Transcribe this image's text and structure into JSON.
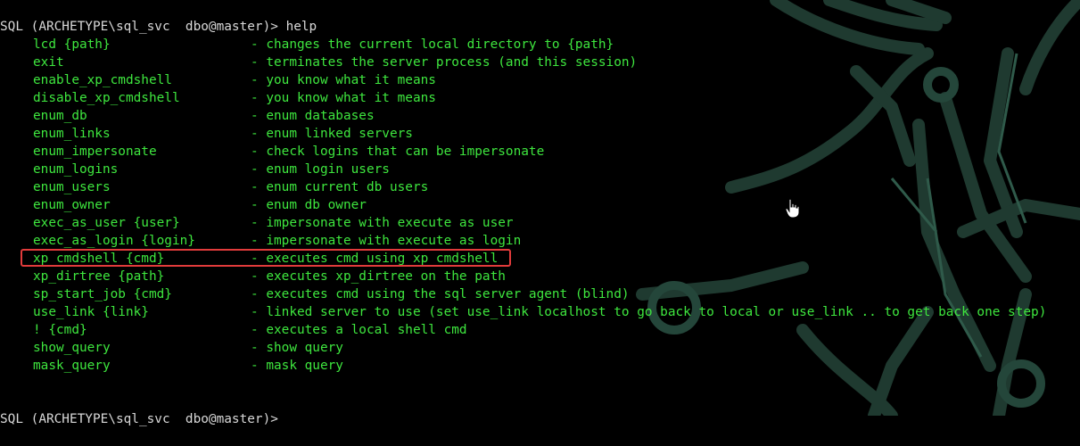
{
  "colors": {
    "background": "#000000",
    "prompt_text": "#d8d8d8",
    "help_text": "#3ee63e",
    "highlight_border": "#e23b3b",
    "watermark": "#1f3a30"
  },
  "terminal": {
    "prompt_1": "SQL (ARCHETYPE\\sql_svc  dbo@master)>",
    "command_1": " help",
    "prompt_2": "SQL (ARCHETYPE\\sql_svc  dbo@master)>",
    "commands": [
      {
        "name": "lcd {path}",
        "desc": "- changes the current local directory to {path}"
      },
      {
        "name": "exit",
        "desc": "- terminates the server process (and this session)"
      },
      {
        "name": "enable_xp_cmdshell",
        "desc": "- you know what it means"
      },
      {
        "name": "disable_xp_cmdshell",
        "desc": "- you know what it means"
      },
      {
        "name": "enum_db",
        "desc": "- enum databases"
      },
      {
        "name": "enum_links",
        "desc": "- enum linked servers"
      },
      {
        "name": "enum_impersonate",
        "desc": "- check logins that can be impersonate"
      },
      {
        "name": "enum_logins",
        "desc": "- enum login users"
      },
      {
        "name": "enum_users",
        "desc": "- enum current db users"
      },
      {
        "name": "enum_owner",
        "desc": "- enum db owner"
      },
      {
        "name": "exec_as_user {user}",
        "desc": "- impersonate with execute as user"
      },
      {
        "name": "exec_as_login {login}",
        "desc": "- impersonate with execute as login"
      },
      {
        "name": "xp_cmdshell {cmd}",
        "desc": "- executes cmd using xp_cmdshell"
      },
      {
        "name": "xp_dirtree {path}",
        "desc": "- executes xp_dirtree on the path"
      },
      {
        "name": "sp_start_job {cmd}",
        "desc": "- executes cmd using the sql server agent (blind)"
      },
      {
        "name": "use_link {link}",
        "desc": "- linked server to use (set use_link localhost to go back to local or use_link .. to get back one step)"
      },
      {
        "name": "! {cmd}",
        "desc": "- executes a local shell cmd"
      },
      {
        "name": "show_query",
        "desc": "- show query"
      },
      {
        "name": "mask_query",
        "desc": "- mask query"
      }
    ]
  }
}
